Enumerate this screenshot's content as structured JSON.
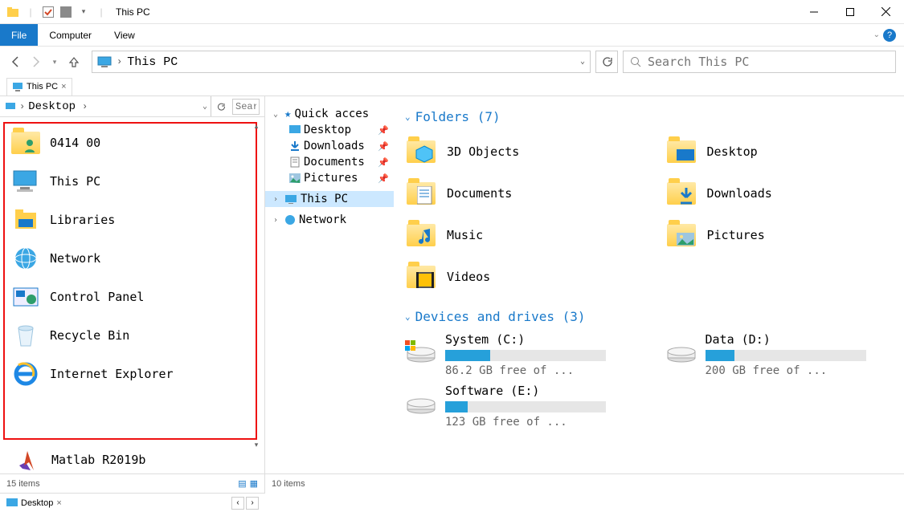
{
  "window": {
    "title": "This PC"
  },
  "ribbon": {
    "file": "File",
    "computer": "Computer",
    "view": "View"
  },
  "nav": {
    "address": "This PC",
    "search_placeholder": "Search This PC"
  },
  "tabstrip": {
    "tab_label": "This PC"
  },
  "left": {
    "crumb": "Desktop",
    "search_placeholder": "Sear",
    "items": [
      {
        "label": "0414 00",
        "icon": "user-folder"
      },
      {
        "label": "This PC",
        "icon": "pc"
      },
      {
        "label": "Libraries",
        "icon": "libraries"
      },
      {
        "label": "Network",
        "icon": "network"
      },
      {
        "label": "Control Panel",
        "icon": "control-panel"
      },
      {
        "label": "Recycle Bin",
        "icon": "recycle-bin"
      },
      {
        "label": "Internet Explorer",
        "icon": "ie"
      }
    ],
    "overflow_item": "Matlab R2019b",
    "status": "15 items"
  },
  "right": {
    "tree": {
      "root": "Quick acces",
      "items": [
        {
          "label": "Desktop",
          "icon": "desktop",
          "pinned": true
        },
        {
          "label": "Downloads",
          "icon": "downloads",
          "pinned": true
        },
        {
          "label": "Documents",
          "icon": "documents",
          "pinned": true
        },
        {
          "label": "Pictures",
          "icon": "pictures",
          "pinned": true
        }
      ],
      "this_pc": "This PC",
      "network": "Network"
    },
    "sections": {
      "folders_head": "Folders (7)",
      "folders": [
        {
          "label": "3D Objects",
          "icon": "3d"
        },
        {
          "label": "Desktop",
          "icon": "desktop"
        },
        {
          "label": "Documents",
          "icon": "documents"
        },
        {
          "label": "Downloads",
          "icon": "downloads"
        },
        {
          "label": "Music",
          "icon": "music"
        },
        {
          "label": "Pictures",
          "icon": "pictures"
        },
        {
          "label": "Videos",
          "icon": "videos"
        }
      ],
      "drives_head": "Devices and drives (3)",
      "drives": [
        {
          "name": "System (C:)",
          "fill": 28,
          "free": "86.2 GB free of ...",
          "win": true
        },
        {
          "name": "Data (D:)",
          "fill": 18,
          "free": "200 GB free of  ..."
        },
        {
          "name": "Software (E:)",
          "fill": 14,
          "free": "123 GB free of  ..."
        }
      ]
    },
    "status": "10 items"
  },
  "bottom_tab": "Desktop"
}
